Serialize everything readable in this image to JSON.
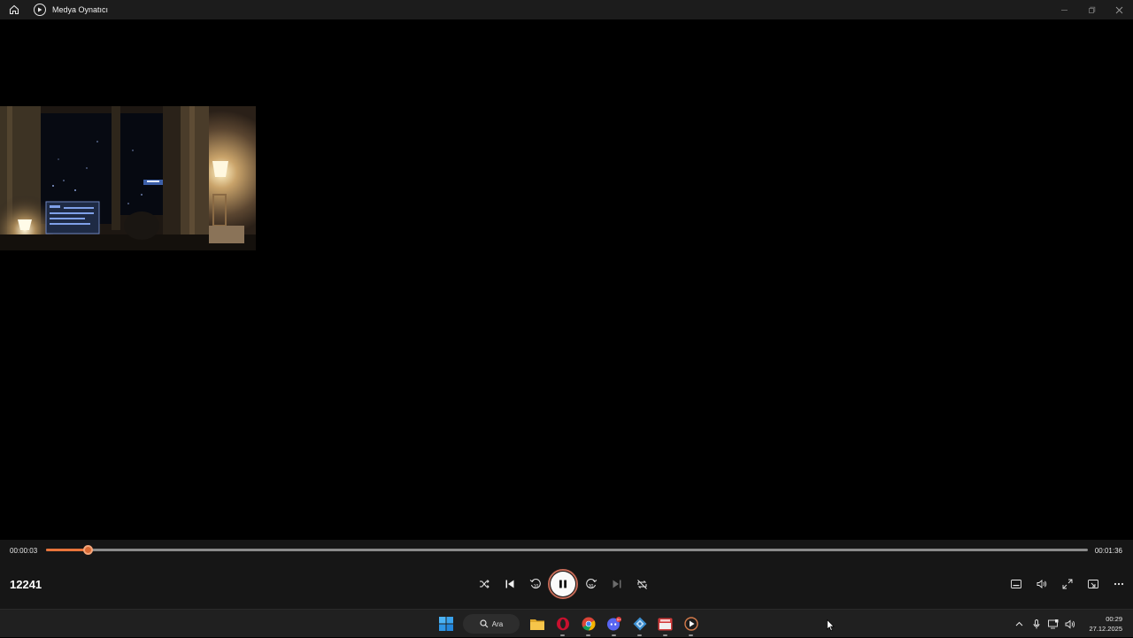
{
  "window": {
    "title": "Medya Oynatıcı"
  },
  "player": {
    "current_time": "00:00:03",
    "total_time": "00:01:36",
    "progress_percent": 4,
    "media_title": "12241",
    "accent_color": "#e8743b",
    "state": "playing"
  },
  "center_controls": [
    {
      "name": "shuffle-button",
      "icon": "shuffle-icon"
    },
    {
      "name": "previous-button",
      "icon": "skip-previous-icon"
    },
    {
      "name": "rewind-10-button",
      "icon": "rewind-10-icon",
      "label": "10"
    },
    {
      "name": "pause-button",
      "icon": "pause-icon"
    },
    {
      "name": "forward-30-button",
      "icon": "forward-30-icon",
      "label": "30"
    },
    {
      "name": "next-button",
      "icon": "skip-next-icon"
    },
    {
      "name": "repeat-off-button",
      "icon": "repeat-off-icon"
    }
  ],
  "right_controls": [
    {
      "name": "captions-button",
      "icon": "captions-icon"
    },
    {
      "name": "volume-button",
      "icon": "volume-icon"
    },
    {
      "name": "fullscreen-button",
      "icon": "fullscreen-icon"
    },
    {
      "name": "miniplayer-button",
      "icon": "miniplayer-icon"
    },
    {
      "name": "more-options-button",
      "icon": "more-icon"
    }
  ],
  "taskbar": {
    "search_label": "Ara",
    "apps": [
      {
        "name": "start-button",
        "icon": "windows-icon"
      },
      {
        "name": "file-explorer",
        "icon": "folder-icon"
      },
      {
        "name": "opera-browser",
        "icon": "opera-icon"
      },
      {
        "name": "chrome-browser",
        "icon": "chrome-icon"
      },
      {
        "name": "discord",
        "icon": "discord-icon",
        "badge": "9+"
      },
      {
        "name": "app-launcher",
        "icon": "app-icon"
      },
      {
        "name": "video-editor",
        "icon": "video-editor-icon"
      },
      {
        "name": "media-player",
        "icon": "media-player-icon"
      }
    ],
    "discord_badge": "9+",
    "tray": {
      "time": "00:29",
      "date": "27.12.2025"
    }
  }
}
